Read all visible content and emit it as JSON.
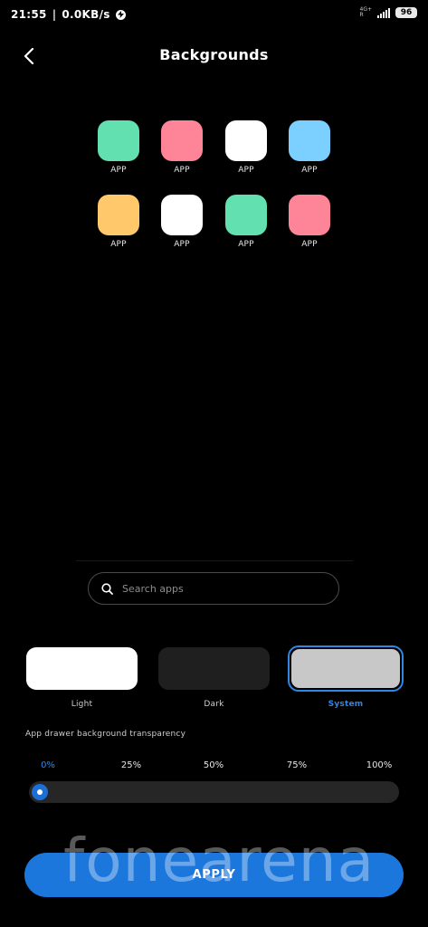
{
  "status_bar": {
    "time": "21:55",
    "separator": "|",
    "speed": "0.0KB/s",
    "network": "4G+",
    "network_sub": "R",
    "battery": "96"
  },
  "header": {
    "title": "Backgrounds",
    "back_icon": "chevron-left-icon"
  },
  "icon_preview": {
    "tiles": [
      {
        "label": "APP",
        "color": "#62e0b0"
      },
      {
        "label": "APP",
        "color": "#fd8597"
      },
      {
        "label": "APP",
        "color": "#ffffff"
      },
      {
        "label": "APP",
        "color": "#7cd0ff"
      },
      {
        "label": "APP",
        "color": "#ffc96b"
      },
      {
        "label": "APP",
        "color": "#ffffff"
      },
      {
        "label": "APP",
        "color": "#62e0b0"
      },
      {
        "label": "APP",
        "color": "#fd8597"
      }
    ]
  },
  "search": {
    "placeholder": "Search apps",
    "icon": "search-icon"
  },
  "theme_options": {
    "selected": "System",
    "items": [
      {
        "label": "Light",
        "color": "#ffffff"
      },
      {
        "label": "Dark",
        "color": "#1f1f1f"
      },
      {
        "label": "System",
        "color": "#c8c8c8"
      }
    ]
  },
  "transparency": {
    "label": "App drawer background transparency",
    "ticks": [
      "0%",
      "25%",
      "50%",
      "75%",
      "100%"
    ],
    "value_fraction": 0
  },
  "apply_button": {
    "label": "APPLY"
  },
  "watermark": "fonearena",
  "colors": {
    "accent": "#2f86e5",
    "background": "#000000"
  }
}
